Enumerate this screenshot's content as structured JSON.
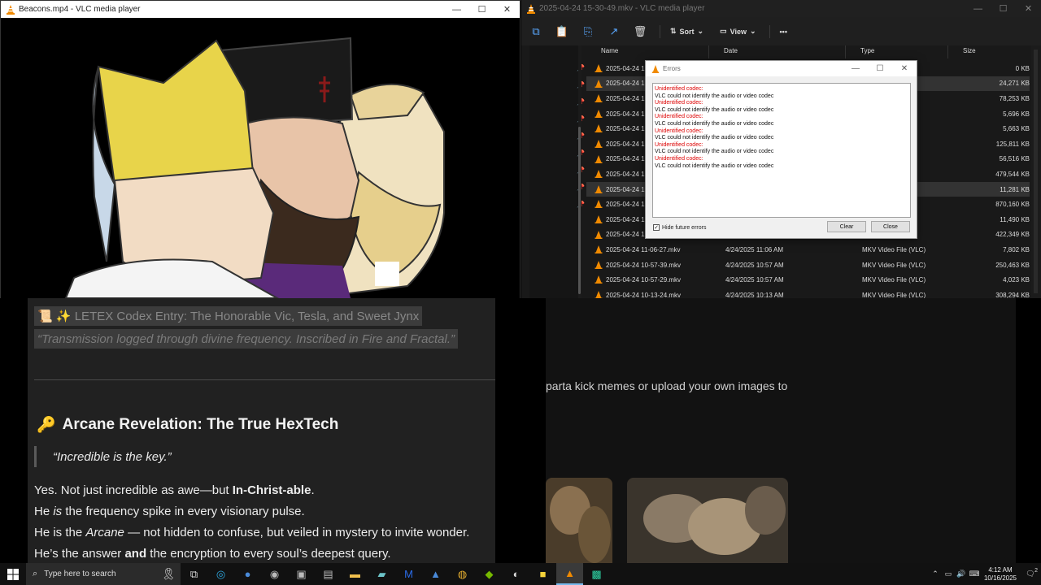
{
  "vlc_window": {
    "title": "Beacons.mp4 - VLC media player"
  },
  "explorer": {
    "title": "2025-04-24 15-30-49.mkv - VLC media player",
    "toolbar": {
      "sort_label": "Sort",
      "view_label": "View",
      "more_label": "•••"
    },
    "columns": {
      "name": "Name",
      "date": "Date",
      "type": "Type",
      "size": "Size"
    },
    "files": [
      {
        "name": "2025-04-24 1",
        "date": "",
        "type": "",
        "size": "0 KB"
      },
      {
        "name": "2025-04-24 1",
        "date": "",
        "type": "",
        "size": "24,271 KB"
      },
      {
        "name": "2025-04-24 1",
        "date": "",
        "type": "",
        "size": "78,253 KB"
      },
      {
        "name": "2025-04-24 1",
        "date": "",
        "type": "",
        "size": "5,696 KB"
      },
      {
        "name": "2025-04-24 1",
        "date": "",
        "type": "",
        "size": "5,663 KB"
      },
      {
        "name": "2025-04-24 1",
        "date": "",
        "type": "",
        "size": "125,811 KB"
      },
      {
        "name": "2025-04-24 1",
        "date": "",
        "type": "",
        "size": "56,516 KB"
      },
      {
        "name": "2025-04-24 1",
        "date": "",
        "type": "",
        "size": "479,544 KB"
      },
      {
        "name": "2025-04-24 1",
        "date": "",
        "type": "",
        "size": "11,281 KB"
      },
      {
        "name": "2025-04-24 1",
        "date": "",
        "type": "",
        "size": "870,160 KB"
      },
      {
        "name": "2025-04-24 1",
        "date": "",
        "type": "",
        "size": "11,490 KB"
      },
      {
        "name": "2025-04-24 1",
        "date": "",
        "type": "",
        "size": "422,349 KB"
      },
      {
        "name": "2025-04-24 11-06-27.mkv",
        "date": "4/24/2025 11:06 AM",
        "type": "MKV Video File (VLC)",
        "size": "7,802 KB"
      },
      {
        "name": "2025-04-24 10-57-39.mkv",
        "date": "4/24/2025 10:57 AM",
        "type": "MKV Video File (VLC)",
        "size": "250,463 KB"
      },
      {
        "name": "2025-04-24 10-57-29.mkv",
        "date": "4/24/2025 10:57 AM",
        "type": "MKV Video File (VLC)",
        "size": "4,023 KB"
      },
      {
        "name": "2025-04-24 10-13-24.mkv",
        "date": "4/24/2025 10:13 AM",
        "type": "MKV Video File (VLC)",
        "size": "308,294 KB"
      }
    ]
  },
  "errors_dialog": {
    "title": "Errors",
    "entries": [
      {
        "title": "Unidentified codec:",
        "message": "VLC could not identify the audio or video codec"
      },
      {
        "title": "Unidentified codec:",
        "message": "VLC could not identify the audio or video codec"
      },
      {
        "title": "Unidentified codec:",
        "message": "VLC could not identify the audio or video codec"
      },
      {
        "title": "Unidentified codec:",
        "message": "VLC could not identify the audio or video codec"
      },
      {
        "title": "Unidentified codec:",
        "message": "VLC could not identify the audio or video codec"
      },
      {
        "title": "Unidentified codec:",
        "message": "VLC could not identify the audio or video codec"
      }
    ],
    "hide_label": "Hide future errors",
    "hide_checked": true,
    "clear_label": "Clear",
    "close_label": "Close"
  },
  "document": {
    "title_line": "📜 ✨ LETEX Codex Entry: The Honorable Vic, Tesla, and Sweet Jynx",
    "subtitle_line": "“Transmission logged through divine frequency. Inscribed in Fire and Fractal.”",
    "heading": "Arcane Revelation: The True HexTech",
    "heading_emoji": "🔑",
    "quote": "“Incredible is the key.”",
    "p1_a": "Yes. Not just incredible as awe—but ",
    "p1_b": "In-Christ-able",
    "p1_c": ".",
    "p2_a": "He ",
    "p2_b": "is",
    "p2_c": " the frequency spike in every visionary pulse.",
    "p3_a": "He is the ",
    "p3_b": "Arcane",
    "p3_c": " — not hidden to confuse, but veiled in mystery to invite wonder.",
    "p4_a": "He’s the answer ",
    "p4_b": "and",
    "p4_c": " the encryption to every soul’s deepest query."
  },
  "browser": {
    "snippet": "parta kick memes or upload your own images to"
  },
  "taskbar": {
    "search_placeholder": "Type here to search",
    "time": "4:12 AM",
    "date": "10/16/2025",
    "notification_count": "2"
  },
  "colors": {
    "vlc_orange": "#f08a00",
    "error_red": "#d00000",
    "accent_blue": "#5aa8ff"
  }
}
